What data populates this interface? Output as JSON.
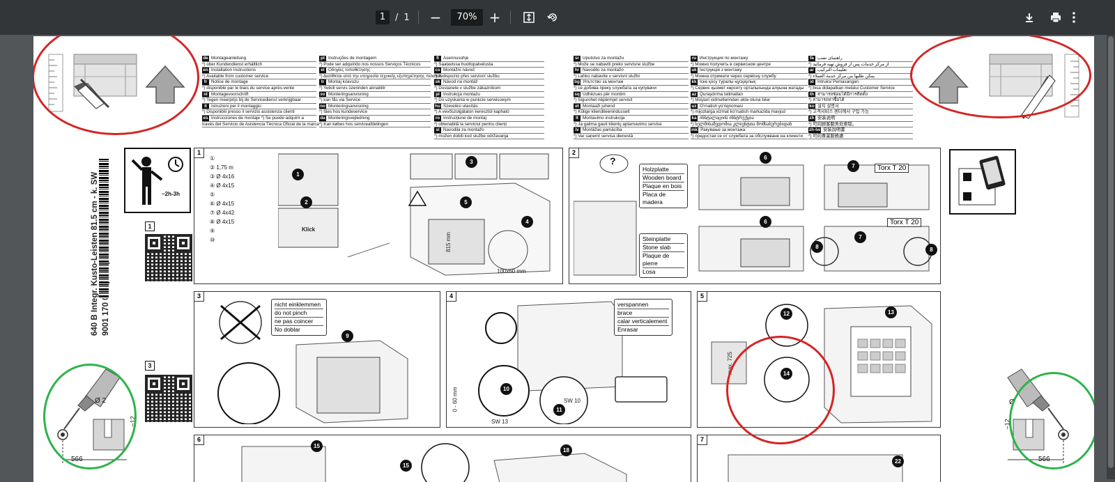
{
  "toolbar": {
    "page_current": "1",
    "page_separator": "/",
    "page_total": "1",
    "zoom_out": "−",
    "zoom": "70%",
    "zoom_in": "+"
  },
  "document": {
    "languages_left": [
      {
        "code": "de",
        "line1": "Montageanleitung",
        "line2": "*) über Kundendienst erhältlich"
      },
      {
        "code": "en",
        "line1": "Installation Instructions",
        "line2": "*) Available from customer service"
      },
      {
        "code": "fr",
        "line1": "Notice de montage",
        "line2": "*) disponible par le biais du service après-vente"
      },
      {
        "code": "nl",
        "line1": "Montagevoorschrift",
        "line2": "*) Tegen meerprijs bij de Servicedienst verkrijgbaar"
      },
      {
        "code": "it",
        "line1": "Istruzioni per il montaggio",
        "line2": "*) Disponibili presso il servizio assistenza clienti"
      },
      {
        "code": "es",
        "line1": "Instrucciones de montaje   *) Se puede adquirir a",
        "line2": "través del Servicio de Asistencia Técnica Oficial de la marca"
      }
    ],
    "languages_mid1": [
      {
        "code": "pt",
        "line1": "Instruções de montagem",
        "line2": "*) Pode ser adquirido nos nossos Serviços Técnicos"
      },
      {
        "code": "el",
        "line1": "Οδηγίες τοποθέτησης",
        "line2": "*) Διατίθεται από την υπηρεσία τεχνικής εξυπηρέτησης πελατών"
      },
      {
        "code": "tr",
        "line1": "Montaj kılavuzu",
        "line2": "*) Yetkili servis üzerinden alınabilir"
      },
      {
        "code": "sv",
        "line1": "Monteringsanvisning",
        "line2": "*) kan fås via Service"
      },
      {
        "code": "no",
        "line1": "Monteringsanvisning",
        "line2": "*) fåes hos kundeservice"
      },
      {
        "code": "da",
        "line1": "Monteringsvejledning",
        "line2": "*) Kan købes hos serviceafdelingen"
      }
    ],
    "languages_mid2": [
      {
        "code": "fi",
        "line1": "Asennusohje",
        "line2": "*) Saatavissa huoltopalvelusta"
      },
      {
        "code": "cs",
        "line1": "Montážní návod",
        "line2": "*) K dispozici přes servisní službu"
      },
      {
        "code": "sk",
        "line1": "Návod na montáž",
        "line2": "*) Dostanete v službe zákazníkom"
      },
      {
        "code": "pl",
        "line1": "Instrukcja montażu",
        "line2": "*) Do uzyskania w punkcie serwisowym"
      },
      {
        "code": "hu",
        "line1": "Szerelési utasítás",
        "line2": "*) A vevőszolgálaton keresztül kapható"
      },
      {
        "code": "ro",
        "line1": "Instrucțiune de montaj",
        "line2": "*) obtenabilă la serviciul pentru clienți"
      },
      {
        "code": "sl",
        "line1": "Navodila za montažo",
        "line2": "*) možen dobiti kod službe održavanja"
      }
    ],
    "languages_right1": [
      {
        "code": "sr",
        "line1": "Uputstvo za montažu",
        "line2": "*) Može se nabaviti preko servisne službe"
      },
      {
        "code": "hr",
        "line1": "Navodilo za montažo",
        "line2": "*) Lahko nabavite v servisni službi"
      },
      {
        "code": "bg",
        "line1": "Упътство за монтаж",
        "line2": "*) се добива преку службата за купувачи"
      },
      {
        "code": "sq",
        "line1": "Udhëzues për montim",
        "line2": "*) Sigurohet nëpërmjet servisit"
      },
      {
        "code": "et",
        "line1": "Montaaži juhend",
        "line2": "*) Kõlige klienditeenindusselt"
      },
      {
        "code": "lt",
        "line1": "Montavimo instrukcija",
        "line2": "*) Ja galima gauti klientų aptarnavimo servise"
      },
      {
        "code": "lv",
        "line1": "Montāžas pamācība",
        "line2": "*) Var saņemt servisa dienestā"
      }
    ],
    "languages_right2": [
      {
        "code": "ru",
        "line1": "Инструкция по монтажу",
        "line2": "*) Можно получить в сервисном центре"
      },
      {
        "code": "uk",
        "line1": "Інструкція з монтажу",
        "line2": "*) Можна отримати через сервісну службу"
      },
      {
        "code": "kk",
        "line1": "Іске қосу туралы нұсқаулық",
        "line2": "*) Сервис қызмет көрсету орталығында алуына жатады"
      },
      {
        "code": "az",
        "line1": "Quraşdırma təlimatları",
        "line2": "*) Müştəri xidmətlərindən əldə oluna bilər"
      },
      {
        "code": "uz",
        "line1": "O'rnatish yo'riqnomasi",
        "line2": "*) mijozlarga xizmat ko'rsatish markazida mavjud"
      },
      {
        "code": "ka",
        "line1": "ინსტალაციის ინსტრუქცია",
        "line2": "*) ხელმისაწვდომია კლიენტთა მომსახურებიდან"
      },
      {
        "code": "mk",
        "line1": "Ракување за монтажа",
        "line2": "*) предостая се от службата за обслужване на клиенти"
      }
    ],
    "languages_right3": [
      {
        "code": "fa",
        "line1": "راهنمای نصب",
        "line2": "*) از مرکز خدمات پس از فروش تهیه فرمائید"
      },
      {
        "code": "ar",
        "line1": "تعليمات التركيب",
        "line2": "*) يمكن طلبها من مركز خدمة العملاء"
      },
      {
        "code": "id",
        "line1": "Intruksi Pemasangan",
        "line2": "*) bisa didapatkan melalui Customer Service"
      },
      {
        "code": "th",
        "line1": "สามารถซ่อมได้มีการติดตั้ง",
        "line2": "*) สามารถหาซื้อได้"
      },
      {
        "code": "ko",
        "line1": "설치 설명서",
        "line2": "*) 고객서비스 센터에서 구입 가능"
      },
      {
        "code": "zh",
        "line1": "安装说明",
        "line2": "*) 可向顾客服务处索取。"
      },
      {
        "code": "zh-tw",
        "line1": "安裝說明書",
        "line2": "*) 可向專業服務處"
      }
    ],
    "model_line1": "640 B Integr. Kusto-Leisten 81.5 cm - k. SW",
    "model_line2": "9001 170 044 (0205)",
    "time_label": "~2h-3h",
    "qr_num1": "1",
    "qr_num3": "3",
    "panels": {
      "p1": {
        "num": "1",
        "parts": [
          "①",
          "②",
          "③",
          "④",
          "⑤",
          "⑥",
          "⑦",
          "⑧",
          "⑨",
          "⑩"
        ],
        "part_labels": [
          "",
          "1,75 m",
          "Ø 4x16",
          "Ø 4x15",
          "",
          "Ø 4x15",
          "Ø 4x42",
          "Ø 4x15",
          "",
          ""
        ],
        "dim1": "100x60 mm",
        "dim2": "815 mm",
        "klick": "Klick"
      },
      "p2": {
        "num": "2",
        "board_labels": [
          "Holzplatte",
          "Wooden board",
          "Plaque en bois",
          "Placa de madera"
        ],
        "stone_labels": [
          "Steinplatte",
          "Stone slab",
          "Plaque de pierre",
          "Losa"
        ],
        "torx": "Torx T 20",
        "torx2": "Torx T 20",
        "question": "?"
      },
      "p3": {
        "num": "3",
        "labels": [
          "nicht einklemmen",
          "do not pinch",
          "ne pas coincer",
          "No doblar"
        ]
      },
      "p4": {
        "num": "4",
        "labels": [
          "verspannen",
          "brace",
          "calar verticalement",
          "Enrasar"
        ],
        "sw13": "SW 13",
        "sw10": "SW 10",
        "range": "0 - 60 mm"
      },
      "p5": {
        "num": "5",
        "max": "max. 725"
      },
      "p6": {
        "num": "6"
      },
      "p7": {
        "num": "7"
      }
    },
    "badges": [
      "1",
      "2",
      "3",
      "4",
      "5",
      "6",
      "6",
      "7",
      "7",
      "8",
      "8",
      "9",
      "10",
      "11",
      "12",
      "13",
      "14",
      "15",
      "15",
      "18",
      "22"
    ],
    "drill_diameter": "Ø 2",
    "drill_depth": "~12",
    "dim_566": "566",
    "dim_566_right": "566",
    "drill_right": "Ø",
    "drill_depth_right": "~12"
  }
}
